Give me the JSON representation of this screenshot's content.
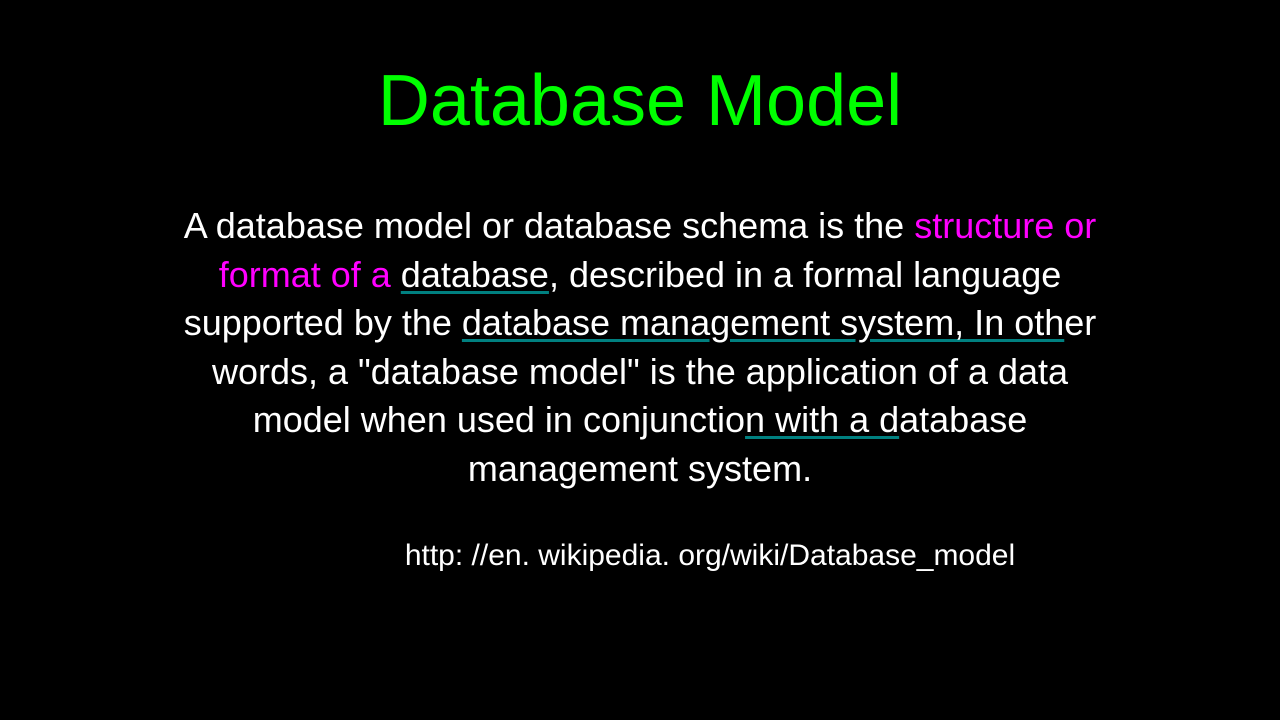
{
  "title": "Database Model",
  "body": {
    "t1": "A database model or database schema is the ",
    "t2": "structure or format of a ",
    "t3": "database",
    "t4": ", described in a formal language supported by the ",
    "t5": "database management system, In oth",
    "t6": "er words, a \"database model\" is the application of a data model when used in conjunctio",
    "t7": "n with a d",
    "t8": "atabase management system."
  },
  "source": "http: //en. wikipedia. org/wiki/Database_model"
}
